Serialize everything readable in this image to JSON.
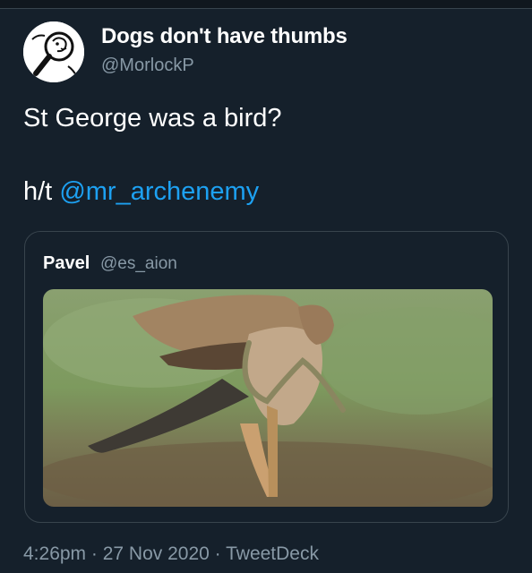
{
  "tweet": {
    "author_name": "Dogs don't have thumbs",
    "author_handle": "@MorlockP",
    "text_line1": "St George was a bird?",
    "text_prefix": "h/t ",
    "mention": "@mr_archenemy",
    "timestamp": "4:26pm",
    "date": "27 Nov 2020",
    "source": "TweetDeck",
    "separator": " · "
  },
  "quoted_tweet": {
    "author_name": "Pavel",
    "author_handle": "@es_aion"
  },
  "icons": {
    "avatar": "dog-magnifier-avatar",
    "media": "hawk-snake-photo"
  },
  "colors": {
    "background": "#15202b",
    "text": "#ffffff",
    "secondary": "#8899a6",
    "accent": "#1da1f2",
    "border": "#38444d"
  }
}
